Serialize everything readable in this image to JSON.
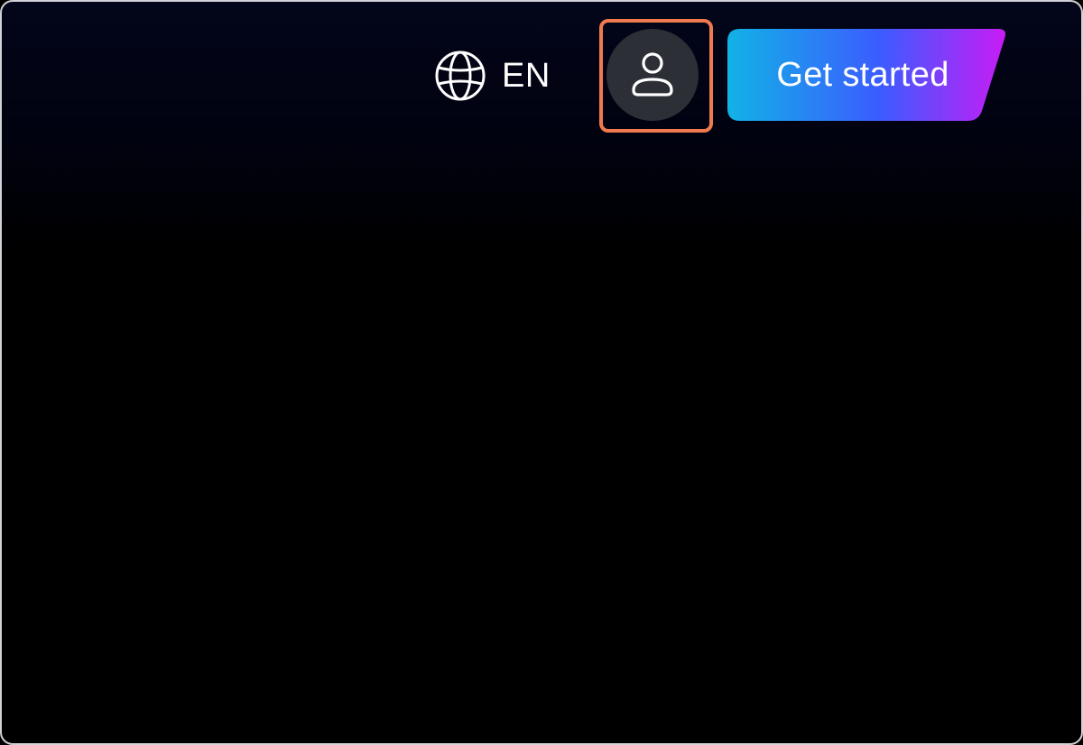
{
  "header": {
    "language": {
      "label": "EN",
      "icon": "globe-icon"
    },
    "account": {
      "icon": "user-icon",
      "highlight_color": "#f07a4e",
      "background_color": "#2c2f36"
    },
    "cta": {
      "label": "Get started",
      "gradient_colors": [
        "#12b2e6",
        "#3b5cff",
        "#c81cf5"
      ]
    }
  },
  "colors": {
    "background": "#000000",
    "text": "#ffffff"
  }
}
